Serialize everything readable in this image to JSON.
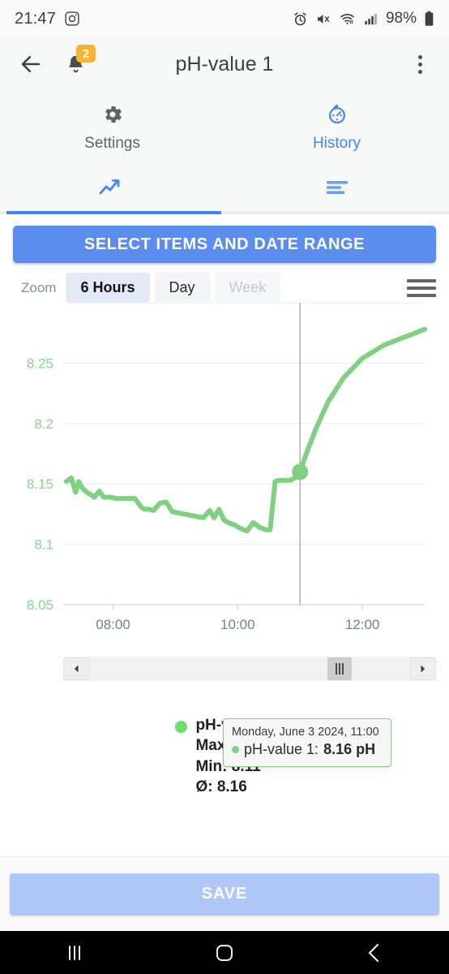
{
  "statusbar": {
    "time": "21:47",
    "battery": "98%",
    "icons": [
      "camera-icon",
      "alarm-icon",
      "mute-icon",
      "wifi-icon",
      "signal-icon",
      "battery-icon"
    ]
  },
  "appbar": {
    "title": "pH-value 1",
    "notification_badge": "2"
  },
  "tabs_top": [
    {
      "label": "Settings",
      "icon": "gear-icon",
      "active": false
    },
    {
      "label": "History",
      "icon": "history-timer-icon",
      "active": true
    }
  ],
  "tabs_sub": [
    {
      "icon": "trending-up-icon",
      "active": true
    },
    {
      "icon": "list-icon",
      "active": false
    }
  ],
  "range_button": {
    "label": "SELECT ITEMS AND DATE RANGE"
  },
  "zoom_controls": {
    "label": "Zoom",
    "options": [
      {
        "label": "6 Hours",
        "state": "selected"
      },
      {
        "label": "Day",
        "state": "normal"
      },
      {
        "label": "Week",
        "state": "disabled"
      }
    ],
    "menu_icon": "hamburger-icon"
  },
  "tooltip": {
    "date": "Monday, June 3 2024, 11:00",
    "series": "pH-value 1:",
    "value": "8.16 pH"
  },
  "legend": {
    "name": "pH-value 1",
    "max": "Max: 8.27",
    "min": "Min: 8.11",
    "avg": "Ø: 8.16",
    "color": "#6fdc6f"
  },
  "navigator": {
    "left_arrow": "◄",
    "right_arrow": "►",
    "grip": "grip-handle"
  },
  "save_button": {
    "label": "SAVE"
  },
  "android_nav": [
    {
      "icon": "recents-icon"
    },
    {
      "icon": "home-icon"
    },
    {
      "icon": "back-icon"
    }
  ],
  "colors": {
    "accent_blue": "#4285f4",
    "button_blue": "#5b8def",
    "series_green": "#7fd081",
    "badge_amber": "#f9b32c",
    "save_disabled": "#afc8f7"
  },
  "chart_data": {
    "type": "line",
    "title": "",
    "xlabel": "",
    "ylabel": "",
    "series_name": "pH-value 1",
    "unit": "pH",
    "color": "#7fd081",
    "ylim": [
      8.05,
      8.3
    ],
    "yticks": [
      "8.05",
      "8.1",
      "8.15",
      "8.2",
      "8.25"
    ],
    "ytick_values": [
      8.05,
      8.1,
      8.15,
      8.2,
      8.25
    ],
    "xticks": [
      "08:00",
      "10:00",
      "12:00"
    ],
    "xtick_hours": [
      8,
      10,
      12
    ],
    "xlim_hours": [
      7.2,
      13.0
    ],
    "grid": true,
    "legend_position": "bottom",
    "crosshair_x_hour": 11,
    "marker": {
      "x_hour": 11,
      "y": 8.16,
      "label": "8.16 pH"
    },
    "stats": {
      "max": 8.27,
      "min": 8.11,
      "avg": 8.16
    },
    "x": [
      7.25,
      7.33,
      7.4,
      7.45,
      7.5,
      7.58,
      7.65,
      7.7,
      7.78,
      7.85,
      7.95,
      8.05,
      8.15,
      8.25,
      8.35,
      8.45,
      8.5,
      8.58,
      8.65,
      8.75,
      8.85,
      8.95,
      9.05,
      9.15,
      9.25,
      9.35,
      9.45,
      9.55,
      9.62,
      9.7,
      9.78,
      9.85,
      9.95,
      10.05,
      10.15,
      10.25,
      10.35,
      10.45,
      10.52,
      10.6,
      10.68,
      10.75,
      10.85,
      10.95,
      11.0,
      11.1,
      11.25,
      11.45,
      11.7,
      12.0,
      12.35,
      12.7,
      13.0
    ],
    "y": [
      8.152,
      8.155,
      8.143,
      8.152,
      8.147,
      8.143,
      8.141,
      8.139,
      8.144,
      8.139,
      8.139,
      8.138,
      8.138,
      8.138,
      8.138,
      8.131,
      8.129,
      8.129,
      8.128,
      8.134,
      8.135,
      8.127,
      8.126,
      8.125,
      8.124,
      8.123,
      8.122,
      8.128,
      8.122,
      8.129,
      8.12,
      8.118,
      8.116,
      8.113,
      8.111,
      8.118,
      8.114,
      8.112,
      8.112,
      8.152,
      8.153,
      8.153,
      8.153,
      8.156,
      8.16,
      8.175,
      8.195,
      8.218,
      8.238,
      8.254,
      8.265,
      8.272,
      8.278
    ]
  }
}
